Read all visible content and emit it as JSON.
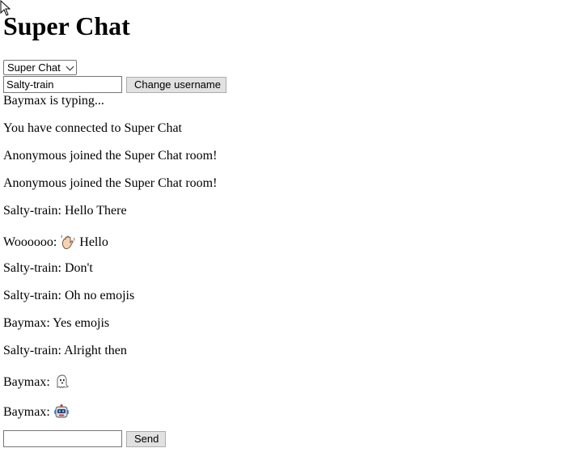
{
  "header": {
    "title": "Super Chat"
  },
  "room_select": {
    "selected": "Super Chat"
  },
  "username": {
    "value": "Salty-train",
    "button_label": "Change username"
  },
  "typing_indicator": "Baymax is typing...",
  "messages": [
    {
      "text": "You have connected to Super Chat"
    },
    {
      "text": "Anonymous joined the Super Chat room!"
    },
    {
      "text": "Anonymous joined the Super Chat room!"
    },
    {
      "text": "Salty-train: Hello There"
    },
    {
      "prefix": "Woooooo: ",
      "emoji": "waving-hand-icon",
      "suffix": " Hello"
    },
    {
      "text": "Salty-train: Don't"
    },
    {
      "text": "Salty-train: Oh no emojis"
    },
    {
      "text": "Baymax: Yes emojis"
    },
    {
      "text": "Salty-train: Alright then"
    },
    {
      "prefix": "Baymax: ",
      "emoji": "ghost-icon",
      "suffix": ""
    },
    {
      "prefix": "Baymax: ",
      "emoji": "robot-icon",
      "suffix": ""
    }
  ],
  "composer": {
    "value": "",
    "send_label": "Send"
  }
}
